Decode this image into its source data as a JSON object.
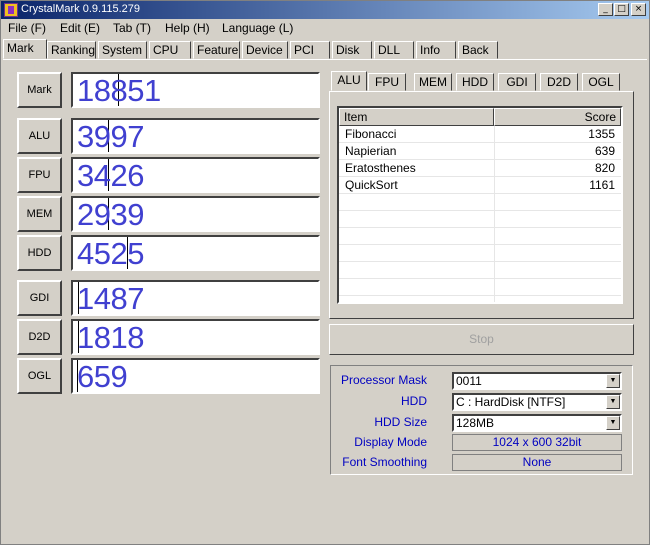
{
  "window": {
    "title": "CrystalMark 0.9.115.279",
    "controls": [
      "_",
      "□",
      "×"
    ]
  },
  "menu": [
    {
      "label": "File (F)"
    },
    {
      "label": "Edit (E)"
    },
    {
      "label": "Tab (T)"
    },
    {
      "label": "Help (H)"
    },
    {
      "label": "Language (L)"
    }
  ],
  "tabs": [
    {
      "label": "Mark",
      "active": true
    },
    {
      "label": "Ranking"
    },
    {
      "label": "System"
    },
    {
      "label": "CPU"
    },
    {
      "label": "Feature"
    },
    {
      "label": "Device"
    },
    {
      "label": "PCI"
    },
    {
      "label": "Disk"
    },
    {
      "label": "DLL"
    },
    {
      "label": "Info"
    },
    {
      "label": "Back"
    }
  ],
  "scores": [
    {
      "label": "Mark",
      "value": "18851"
    },
    {
      "label": "ALU",
      "value": "3997"
    },
    {
      "label": "FPU",
      "value": "3426"
    },
    {
      "label": "MEM",
      "value": "2939"
    },
    {
      "label": "HDD",
      "value": "4525"
    },
    {
      "label": "GDI",
      "value": "1487"
    },
    {
      "label": "D2D",
      "value": "1818"
    },
    {
      "label": "OGL",
      "value": "659"
    }
  ],
  "detail_tabs": [
    {
      "label": "ALU",
      "active": true
    },
    {
      "label": "FPU"
    },
    {
      "label": "MEM"
    },
    {
      "label": "HDD"
    },
    {
      "label": "GDI"
    },
    {
      "label": "D2D"
    },
    {
      "label": "OGL"
    }
  ],
  "table": {
    "headers": {
      "item": "Item",
      "score": "Score"
    },
    "rows": [
      {
        "item": "Fibonacci",
        "score": "1355"
      },
      {
        "item": "Napierian",
        "score": "639"
      },
      {
        "item": "Eratosthenes",
        "score": "820"
      },
      {
        "item": "QuickSort",
        "score": "1161"
      }
    ]
  },
  "stop_button": "Stop",
  "settings": {
    "processor_mask": {
      "label": "Processor Mask",
      "value": "0011"
    },
    "hdd": {
      "label": "HDD",
      "value": "C : HardDisk [NTFS]"
    },
    "hdd_size": {
      "label": "HDD Size",
      "value": "128MB"
    },
    "display_mode": {
      "label": "Display Mode",
      "value": "1024 x 600 32bit"
    },
    "font_smoothing": {
      "label": "Font Smoothing",
      "value": "None"
    }
  }
}
